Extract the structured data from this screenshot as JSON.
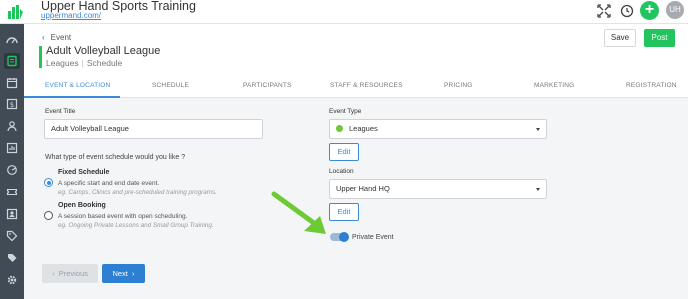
{
  "app": {
    "brand_name": "Upper Hand Sports Training",
    "brand_url": "uppermand.com/",
    "user_initials": "UH",
    "accent_green": "#22c45e",
    "accent_blue": "#2d7fd3",
    "top_icons": [
      "fullscreen-icon",
      "clock-icon",
      "plus-icon"
    ]
  },
  "sidebar": {
    "items": [
      "dashboard-icon",
      "events-icon",
      "calendar-icon",
      "finance-icon",
      "team-icon",
      "reports-icon",
      "marketing-icon",
      "tickets-icon",
      "contacts-icon",
      "tags-icon",
      "sessions-icon",
      "settings-icon"
    ]
  },
  "header": {
    "back_label": "Event",
    "event_title": "Adult Volleyball League",
    "event_type": "Leagues",
    "section": "Schedule",
    "save_label": "Save",
    "post_label": "Post"
  },
  "tabs": [
    {
      "label": "EVENT & LOCATION",
      "active": true
    },
    {
      "label": "SCHEDULE",
      "active": false
    },
    {
      "label": "PARTICIPANTS",
      "active": false
    },
    {
      "label": "STAFF & RESOURCES",
      "active": false
    },
    {
      "label": "PRICING",
      "active": false
    },
    {
      "label": "MARKETING",
      "active": false
    },
    {
      "label": "REGISTRATION",
      "active": false
    }
  ],
  "form": {
    "event_title_label": "Event Title",
    "event_title_value": "Adult Volleyball League",
    "schedule_question": "What type of event schedule would you like ?",
    "options": [
      {
        "title": "Fixed Schedule",
        "description": "A specific start and end date event.",
        "example": "eg. Camps, Clinics and pre-scheduled training programs.",
        "selected": true
      },
      {
        "title": "Open Booking",
        "description": "A session based event with open scheduling.",
        "example": "eg. Ongoing Private Lessons and Small Group Training.",
        "selected": false
      }
    ],
    "event_type_label": "Event Type",
    "event_type_value": "Leagues",
    "event_type_color": "#6dc934",
    "edit_label": "Edit",
    "location_label": "Location",
    "location_value": "Upper Hand HQ",
    "private_event_label": "Private Event",
    "private_event_on": true
  },
  "footer": {
    "previous_label": "Previous",
    "next_label": "Next"
  }
}
